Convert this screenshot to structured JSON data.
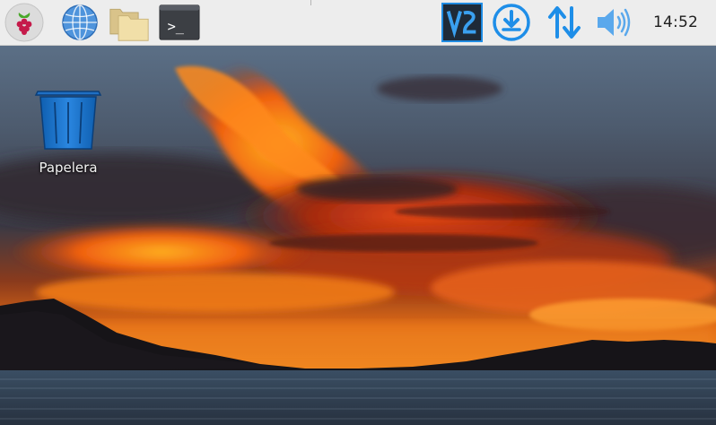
{
  "taskbar": {
    "menu_icon": "raspberry-pi-menu-icon",
    "launchers": [
      {
        "name": "web-browser",
        "icon": "globe-icon"
      },
      {
        "name": "file-manager",
        "icon": "folder-icon"
      },
      {
        "name": "terminal",
        "icon": "terminal-icon",
        "glyph": ">_"
      }
    ],
    "tray": {
      "vnc_icon": "vnc-icon",
      "vnc_glyph": "V2",
      "update_icon": "download-icon",
      "network_icon": "network-arrows-icon",
      "volume_icon": "speaker-icon",
      "clock": "14:52"
    },
    "accent_color": "#1e8ee8",
    "background_color": "#ededed"
  },
  "desktop": {
    "icons": [
      {
        "label": "Papelera",
        "icon": "trash-icon"
      }
    ],
    "wallpaper": "sunset-over-lake"
  }
}
